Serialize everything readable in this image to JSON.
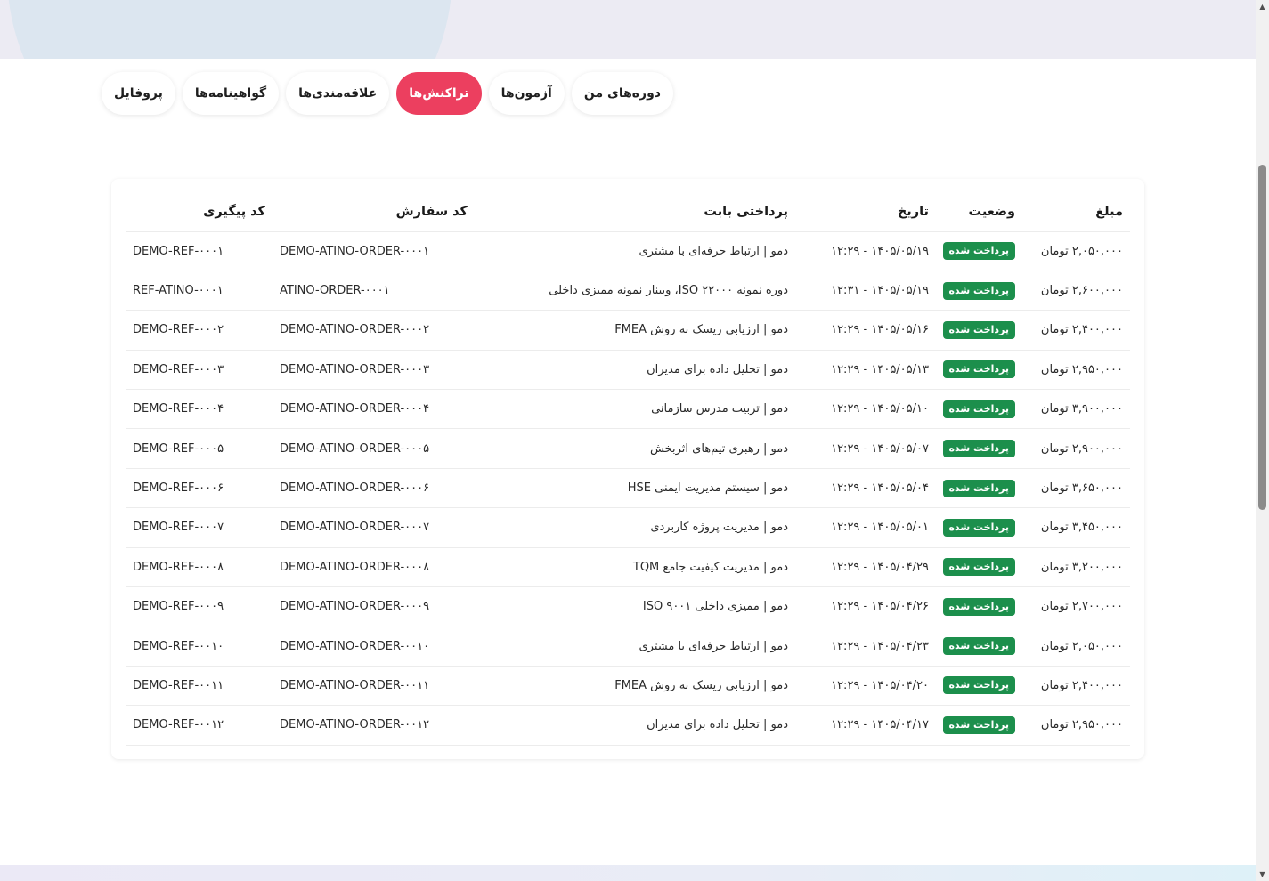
{
  "tabs": [
    {
      "label": "دوره‌های من",
      "active": false
    },
    {
      "label": "آزمون‌ها",
      "active": false
    },
    {
      "label": "تراکنش‌ها",
      "active": true
    },
    {
      "label": "علاقه‌مندی‌ها",
      "active": false
    },
    {
      "label": "گواهینامه‌ها",
      "active": false
    },
    {
      "label": "پروفایل",
      "active": false
    }
  ],
  "table": {
    "headers": {
      "amount": "مبلغ",
      "status": "وضعیت",
      "date": "تاریخ",
      "description": "پرداختی بابت",
      "order_code": "کد سفارش",
      "tracking_code": "کد پیگیری"
    },
    "rows": [
      {
        "amount": "۲,۰۵۰,۰۰۰ تومان",
        "status": "پرداخت شده",
        "date": "۱۴۰۵/۰۵/۱۹ - ۱۲:۲۹",
        "description": "دمو | ارتباط حرفه‌ای با مشتری",
        "order_code": "DEMO-ATINO-ORDER-۰۰۰۱",
        "tracking_code": "DEMO-REF-۰۰۰۱"
      },
      {
        "amount": "۲,۶۰۰,۰۰۰ تومان",
        "status": "پرداخت شده",
        "date": "۱۴۰۵/۰۵/۱۹ - ۱۲:۳۱",
        "description": "دوره نمونه ۲۲۰۰۰ ISO، وبینار نمونه ممیزی داخلی",
        "order_code": "ATINO-ORDER-۰۰۰۱",
        "tracking_code": "REF-ATINO-۰۰۰۱"
      },
      {
        "amount": "۲,۴۰۰,۰۰۰ تومان",
        "status": "پرداخت شده",
        "date": "۱۴۰۵/۰۵/۱۶ - ۱۲:۲۹",
        "description": "دمو | ارزیابی ریسک به روش FMEA",
        "order_code": "DEMO-ATINO-ORDER-۰۰۰۲",
        "tracking_code": "DEMO-REF-۰۰۰۲"
      },
      {
        "amount": "۲,۹۵۰,۰۰۰ تومان",
        "status": "پرداخت شده",
        "date": "۱۴۰۵/۰۵/۱۳ - ۱۲:۲۹",
        "description": "دمو | تحلیل داده برای مدیران",
        "order_code": "DEMO-ATINO-ORDER-۰۰۰۳",
        "tracking_code": "DEMO-REF-۰۰۰۳"
      },
      {
        "amount": "۳,۹۰۰,۰۰۰ تومان",
        "status": "پرداخت شده",
        "date": "۱۴۰۵/۰۵/۱۰ - ۱۲:۲۹",
        "description": "دمو | تربیت مدرس سازمانی",
        "order_code": "DEMO-ATINO-ORDER-۰۰۰۴",
        "tracking_code": "DEMO-REF-۰۰۰۴"
      },
      {
        "amount": "۲,۹۰۰,۰۰۰ تومان",
        "status": "پرداخت شده",
        "date": "۱۴۰۵/۰۵/۰۷ - ۱۲:۲۹",
        "description": "دمو | رهبری تیم‌های اثربخش",
        "order_code": "DEMO-ATINO-ORDER-۰۰۰۵",
        "tracking_code": "DEMO-REF-۰۰۰۵"
      },
      {
        "amount": "۳,۶۵۰,۰۰۰ تومان",
        "status": "پرداخت شده",
        "date": "۱۴۰۵/۰۵/۰۴ - ۱۲:۲۹",
        "description": "دمو | سیستم مدیریت ایمنی HSE",
        "order_code": "DEMO-ATINO-ORDER-۰۰۰۶",
        "tracking_code": "DEMO-REF-۰۰۰۶"
      },
      {
        "amount": "۳,۴۵۰,۰۰۰ تومان",
        "status": "پرداخت شده",
        "date": "۱۴۰۵/۰۵/۰۱ - ۱۲:۲۹",
        "description": "دمو | مدیریت پروژه کاربردی",
        "order_code": "DEMO-ATINO-ORDER-۰۰۰۷",
        "tracking_code": "DEMO-REF-۰۰۰۷"
      },
      {
        "amount": "۳,۲۰۰,۰۰۰ تومان",
        "status": "پرداخت شده",
        "date": "۱۴۰۵/۰۴/۲۹ - ۱۲:۲۹",
        "description": "دمو | مدیریت کیفیت جامع TQM",
        "order_code": "DEMO-ATINO-ORDER-۰۰۰۸",
        "tracking_code": "DEMO-REF-۰۰۰۸"
      },
      {
        "amount": "۲,۷۰۰,۰۰۰ تومان",
        "status": "پرداخت شده",
        "date": "۱۴۰۵/۰۴/۲۶ - ۱۲:۲۹",
        "description": "دمو | ممیزی داخلی ۹۰۰۱ ISO",
        "order_code": "DEMO-ATINO-ORDER-۰۰۰۹",
        "tracking_code": "DEMO-REF-۰۰۰۹"
      },
      {
        "amount": "۲,۰۵۰,۰۰۰ تومان",
        "status": "پرداخت شده",
        "date": "۱۴۰۵/۰۴/۲۳ - ۱۲:۲۹",
        "description": "دمو | ارتباط حرفه‌ای با مشتری",
        "order_code": "DEMO-ATINO-ORDER-۰۰۱۰",
        "tracking_code": "DEMO-REF-۰۰۱۰"
      },
      {
        "amount": "۲,۴۰۰,۰۰۰ تومان",
        "status": "پرداخت شده",
        "date": "۱۴۰۵/۰۴/۲۰ - ۱۲:۲۹",
        "description": "دمو | ارزیابی ریسک به روش FMEA",
        "order_code": "DEMO-ATINO-ORDER-۰۰۱۱",
        "tracking_code": "DEMO-REF-۰۰۱۱"
      },
      {
        "amount": "۲,۹۵۰,۰۰۰ تومان",
        "status": "پرداخت شده",
        "date": "۱۴۰۵/۰۴/۱۷ - ۱۲:۲۹",
        "description": "دمو | تحلیل داده برای مدیران",
        "order_code": "DEMO-ATINO-ORDER-۰۰۱۲",
        "tracking_code": "DEMO-REF-۰۰۱۲"
      }
    ]
  },
  "colors": {
    "accent": "#ec3f5f",
    "status_paid": "#1c8f4c",
    "hero_background": "#ecebf3"
  },
  "icons": {
    "scroll_up": "scroll-up-arrow-icon",
    "scroll_down": "scroll-down-arrow-icon"
  }
}
